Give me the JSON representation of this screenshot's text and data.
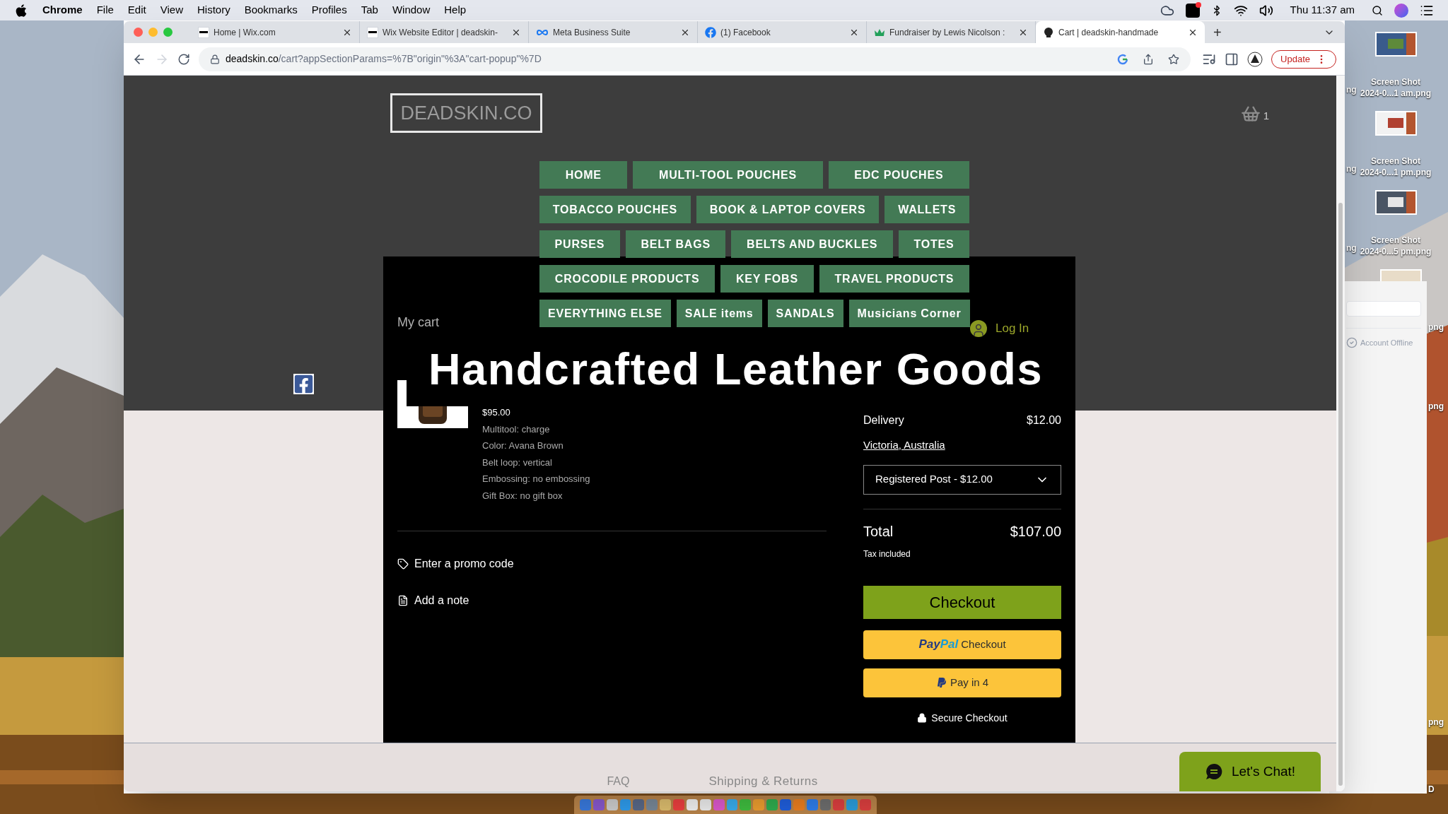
{
  "menu_bar": {
    "app": "Chrome",
    "items": [
      "File",
      "Edit",
      "View",
      "History",
      "Bookmarks",
      "Profiles",
      "Tab",
      "Window",
      "Help"
    ],
    "clock": "Thu 11:37 am"
  },
  "browser": {
    "tabs": [
      {
        "title": "Home | Wix.com",
        "kind": "wix",
        "selected": false
      },
      {
        "title": "Wix Website Editor | deadskin-",
        "kind": "wix",
        "selected": false
      },
      {
        "title": "Meta Business Suite",
        "kind": "meta",
        "selected": false
      },
      {
        "title": "(1) Facebook",
        "kind": "facebook",
        "selected": false
      },
      {
        "title": "Fundraiser by Lewis Nicolson :",
        "kind": "fundraiser",
        "selected": false
      },
      {
        "title": "Cart | deadskin-handmade",
        "kind": "deadskin",
        "selected": true
      }
    ],
    "new_tab": "+",
    "url": {
      "host": "deadskin.co",
      "path": "/cart?appSectionParams=%7B\"origin\"%3A\"cart-popup\"%7D"
    },
    "update_button": "Update"
  },
  "site": {
    "logo": "DEADSKIN.CO",
    "cart_count": "1",
    "nav": [
      [
        "HOME",
        "MULTI-TOOL POUCHES",
        "EDC POUCHES"
      ],
      [
        "TOBACCO POUCHES",
        "BOOK & LAPTOP COVERS",
        "WALLETS"
      ],
      [
        "PURSES",
        "BELT BAGS",
        "BELTS AND BUCKLES",
        "TOTES"
      ],
      [
        "CROCODILE PRODUCTS",
        "KEY FOBS",
        "TRAVEL PRODUCTS"
      ],
      [
        "EVERYTHING ELSE",
        "SALE items",
        "SANDALS",
        "Musicians Corner"
      ]
    ],
    "login": "Log In",
    "banner": "Handcrafted Leather Goods",
    "chat_button": "Let's Chat!",
    "footer_links": [
      "FAQ",
      "Shipping & Returns"
    ]
  },
  "cart": {
    "title": "My cart",
    "price": "$95.00",
    "options": [
      "Multitool: charge",
      "Color: Avana Brown",
      "Belt loop: vertical",
      "Embossing: no embossing",
      "Gift Box: no gift box"
    ],
    "promo": "Enter a promo code",
    "note": "Add a note"
  },
  "summary": {
    "delivery_label": "Delivery",
    "delivery_price": "$12.00",
    "location": "Victoria, Australia",
    "shipping_select": "Registered Post - $12.00",
    "total_label": "Total",
    "total": "$107.00",
    "tax_note": "Tax included",
    "checkout": "Checkout",
    "paypal": {
      "brand_first": "Pay",
      "brand_second": "Pal",
      "label": "Checkout"
    },
    "pay_in_4": "Pay in 4",
    "secure": "Secure Checkout"
  },
  "desktop": {
    "files": [
      {
        "line_1": "Screen Shot",
        "line_2": "2024-0...1 am.png"
      },
      {
        "line_1": "Screen Shot",
        "line_2": "2024-0...1 pm.png"
      },
      {
        "line_1": "Screen Shot",
        "line_2": "2024-0...5 pm.png"
      }
    ],
    "left_fragments": [
      "ng",
      "ng",
      "ng"
    ],
    "right_fragments": [
      "png",
      "png",
      "png",
      "D"
    ]
  },
  "side_panel": {
    "status": "Account Offline"
  }
}
